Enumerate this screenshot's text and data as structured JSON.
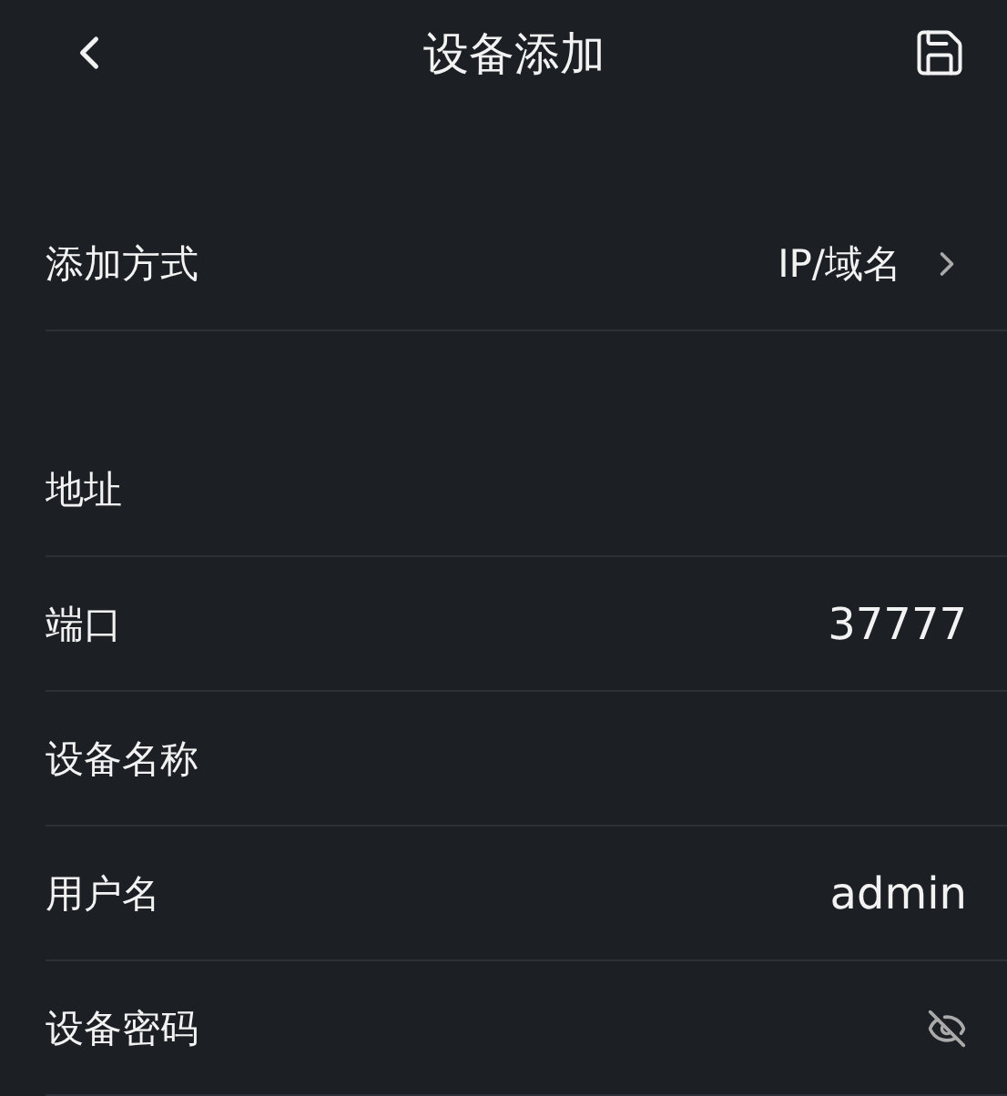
{
  "header": {
    "title": "设备添加"
  },
  "add_method": {
    "label": "添加方式",
    "value": "IP/域名"
  },
  "fields": [
    {
      "label": "地址",
      "kind": "text"
    },
    {
      "label": "端口",
      "value": "37777",
      "kind": "text"
    },
    {
      "label": "设备名称",
      "kind": "text"
    },
    {
      "label": "用户名",
      "value": "admin",
      "kind": "text"
    },
    {
      "label": "设备密码",
      "kind": "password"
    }
  ]
}
